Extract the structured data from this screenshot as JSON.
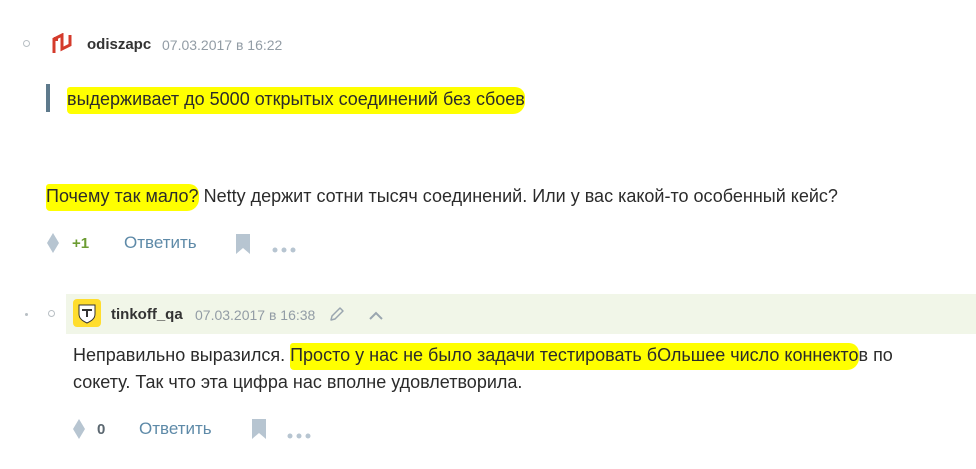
{
  "comment1": {
    "username": "odiszapc",
    "timestamp": "07.03.2017 в 16:22",
    "quote": "выдерживает до 5000 открытых соединений без сбоев",
    "body_highlight": "Почему так мало?",
    "body_rest": " Netty держит сотни тысяч соединений. Или у вас какой-то особенный кейс?",
    "votes": "+1",
    "reply_label": "Ответить",
    "avatar_icon": "odiszapc-identicon",
    "accent_color": "#d43b2c"
  },
  "comment2": {
    "username": "tinkoff_qa",
    "timestamp": "07.03.2017 в 16:38",
    "body_plain_1": "Неправильно выразился. ",
    "body_highlight": "Просто у нас не было задачи тестировать бОльшее число коннекто",
    "body_plain_2": "в по",
    "body_line2": "сокету. Так что эта цифра нас вполне удовлетворила.",
    "votes": "0",
    "reply_label": "Ответить",
    "avatar_icon": "tinkoff-logo-avatar",
    "header_bg": "#f1f6e8"
  },
  "highlight_color": "#ffff00"
}
